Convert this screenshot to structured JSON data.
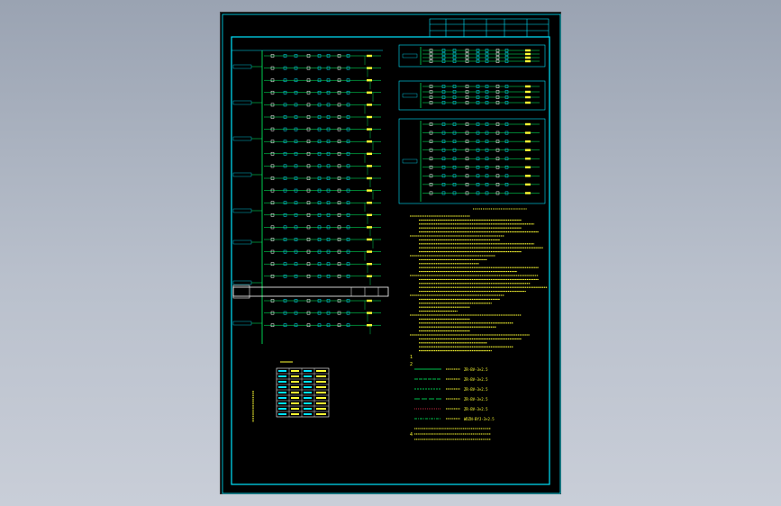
{
  "sheet": {
    "frame_color": "#00e5ff",
    "wire_color": "#00ff66",
    "text_color": "#ffff33",
    "symbol_color": "#ffffff",
    "alert_color": "#ff3355"
  },
  "notes": {
    "item_1": "1",
    "item_2": "2",
    "item_4": "4"
  },
  "legend_lines": [
    {
      "code": "ZR-BV-3×2.5"
    },
    {
      "code": "ZR-BV-3×2.5"
    },
    {
      "code": "ZR-BV-3×2.5"
    },
    {
      "code": "ZR-BV-3×2.5"
    },
    {
      "code": "ZR-BV-3×2.5"
    },
    {
      "code": "WDZN-BYJ-3×2.5"
    }
  ]
}
